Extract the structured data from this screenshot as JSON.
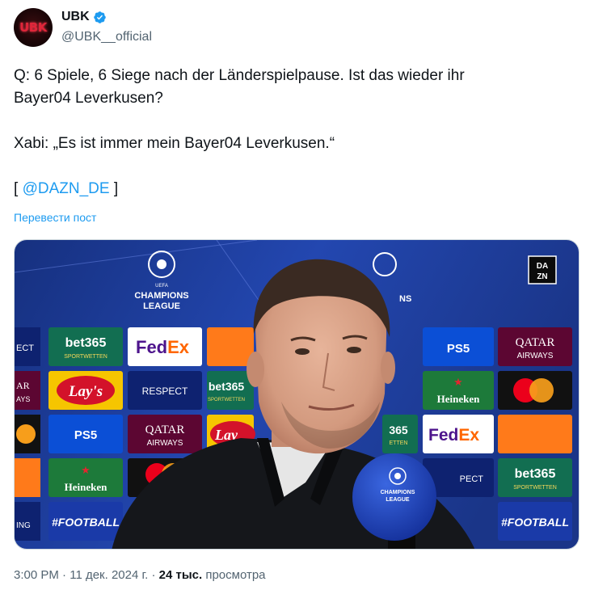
{
  "author": {
    "avatar_text": "UBK",
    "display_name": "UBK",
    "handle": "@UBK__official",
    "verified": true,
    "verified_icon": "verified-badge-icon"
  },
  "tweet": {
    "line1": "Q: 6 Spiele, 6 Siege nach der Länderspielpause. Ist das wieder ihr",
    "line2": "Bayer04 Leverkusen?",
    "line3": "Xabi: „Es ist immer mein Bayer04 Leverkusen.“",
    "bracket_open": "[ ",
    "mention": "@DAZN_DE",
    "bracket_close": " ]"
  },
  "translate_label": "Перевести пост",
  "media": {
    "ucl_text_line1": "CHAMPIONS",
    "ucl_text_line2": "LEAGUE",
    "uefa": "UEFA",
    "ucl_partial": "NS",
    "dazn_line1": "DA",
    "dazn_line2": "ZN",
    "mic_line1": "CHAMPIONS",
    "mic_line2": "LEAGUE",
    "sponsors": {
      "bet365": "bet365",
      "bet365_sub": "SPORTWETTEN",
      "fedex_a": "Fed",
      "fedex_b": "Ex",
      "ps5": "PS5",
      "qatar_line1": "QATAR",
      "qatar_line2": "AIRWAYS",
      "lays": "Lay's",
      "respect": "RESPECT",
      "respect_partial": "ECT",
      "respect_partial2": "PECT",
      "heineken": "Heineken",
      "football": "#FOOTBALL",
      "ar": "AR",
      "ays": "AYS",
      "ing": "ING",
      "n365": "365",
      "ten": "ETTEN",
      "lay": "Lay"
    },
    "colors": {
      "board_bg": "#1f3d9a",
      "bet365_green": "#126e51",
      "fedex_purple": "#4d148c",
      "fedex_orange": "#ff6600",
      "ps5_blue": "#0b4fd6",
      "qatar_maroon": "#5c0632",
      "heineken_green": "#1d7a3a",
      "lays_red": "#d3122a",
      "lays_yellow": "#f6c500",
      "delivery_orange": "#ff7a1a"
    }
  },
  "meta": {
    "time": "3:00 PM",
    "sep": " · ",
    "date": "11 дек. 2024 г.",
    "sep2": " · ",
    "views_count": "24 тыс.",
    "views_label": " просмотра"
  }
}
